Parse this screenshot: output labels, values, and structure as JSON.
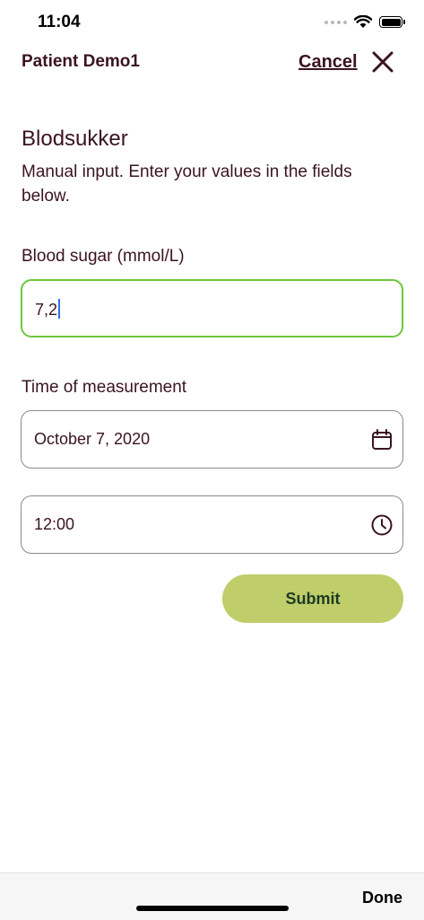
{
  "status_bar": {
    "time": "11:04"
  },
  "header": {
    "patient_name": "Patient Demo1",
    "cancel_label": "Cancel",
    "close_icon": "close-icon"
  },
  "form": {
    "title": "Blodsukker",
    "subtitle": "Manual input. Enter your values in the fields below.",
    "blood_sugar": {
      "label": "Blood sugar (mmol/L)",
      "value": "7,2"
    },
    "time_of_measurement": {
      "label": "Time of measurement",
      "date_value": "October 7, 2020",
      "date_icon": "calendar-icon",
      "time_value": "12:00",
      "time_icon": "clock-icon"
    },
    "submit_label": "Submit"
  },
  "keyboard_toolbar": {
    "done_label": "Done"
  },
  "colors": {
    "text_primary": "#3a1420",
    "active_border": "#6cc63a",
    "submit_background": "#bfcd6a",
    "submit_text": "#1c3a24",
    "caret": "#2f6df3"
  }
}
